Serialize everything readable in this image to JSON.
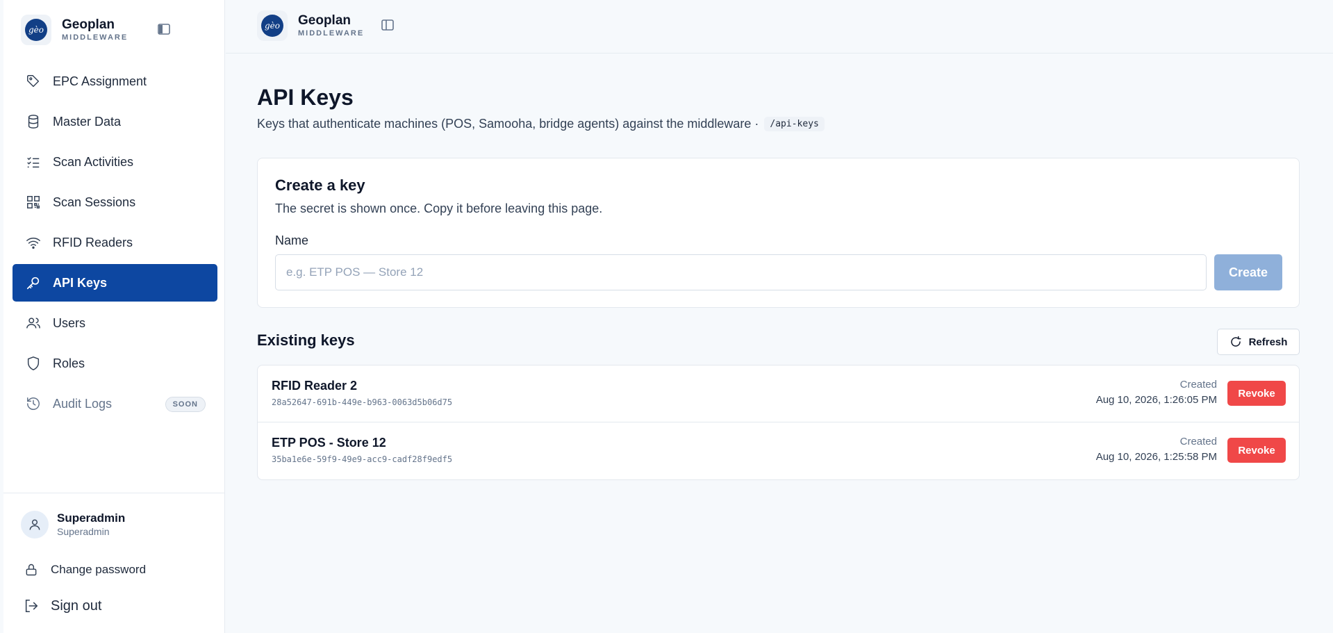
{
  "brand": {
    "logo_text": "gèo",
    "name": "Geoplan",
    "subtitle": "MIDDLEWARE"
  },
  "sidebar": {
    "items": [
      {
        "label": "EPC Assignment",
        "icon": "tag-icon"
      },
      {
        "label": "Master Data",
        "icon": "database-icon"
      },
      {
        "label": "Scan Activities",
        "icon": "list-check-icon"
      },
      {
        "label": "Scan Sessions",
        "icon": "qr-code-icon"
      },
      {
        "label": "RFID Readers",
        "icon": "wifi-icon"
      },
      {
        "label": "API Keys",
        "icon": "key-icon",
        "active": true
      },
      {
        "label": "Users",
        "icon": "users-icon"
      },
      {
        "label": "Roles",
        "icon": "shield-icon"
      },
      {
        "label": "Audit Logs",
        "icon": "history-icon",
        "badge": "SOON"
      }
    ],
    "user": {
      "name": "Superadmin",
      "role": "Superadmin"
    },
    "change_password": "Change password",
    "sign_out": "Sign out"
  },
  "page": {
    "title": "API Keys",
    "description": "Keys that authenticate machines (POS, Samooha, bridge agents) against the middleware ·",
    "endpoint": "/api-keys"
  },
  "create": {
    "title": "Create a key",
    "subtitle": "The secret is shown once. Copy it before leaving this page.",
    "name_label": "Name",
    "name_value": "",
    "name_placeholder": "e.g. ETP POS — Store 12",
    "button": "Create"
  },
  "existing": {
    "title": "Existing keys",
    "refresh": "Refresh",
    "keys": [
      {
        "name": "RFID Reader 2",
        "id": "28a52647-691b-449e-b963-0063d5b06d75",
        "created_label": "Created",
        "created": "Aug 10, 2026, 1:26:05 PM",
        "action": "Revoke"
      },
      {
        "name": "ETP POS - Store 12",
        "id": "35ba1e6e-59f9-49e9-acc9-cadf28f9edf5",
        "created_label": "Created",
        "created": "Aug 10, 2026, 1:25:58 PM",
        "action": "Revoke"
      }
    ]
  },
  "colors": {
    "accent": "#0d47a1",
    "danger": "#f04848",
    "create_disabled": "#8fb0da"
  }
}
